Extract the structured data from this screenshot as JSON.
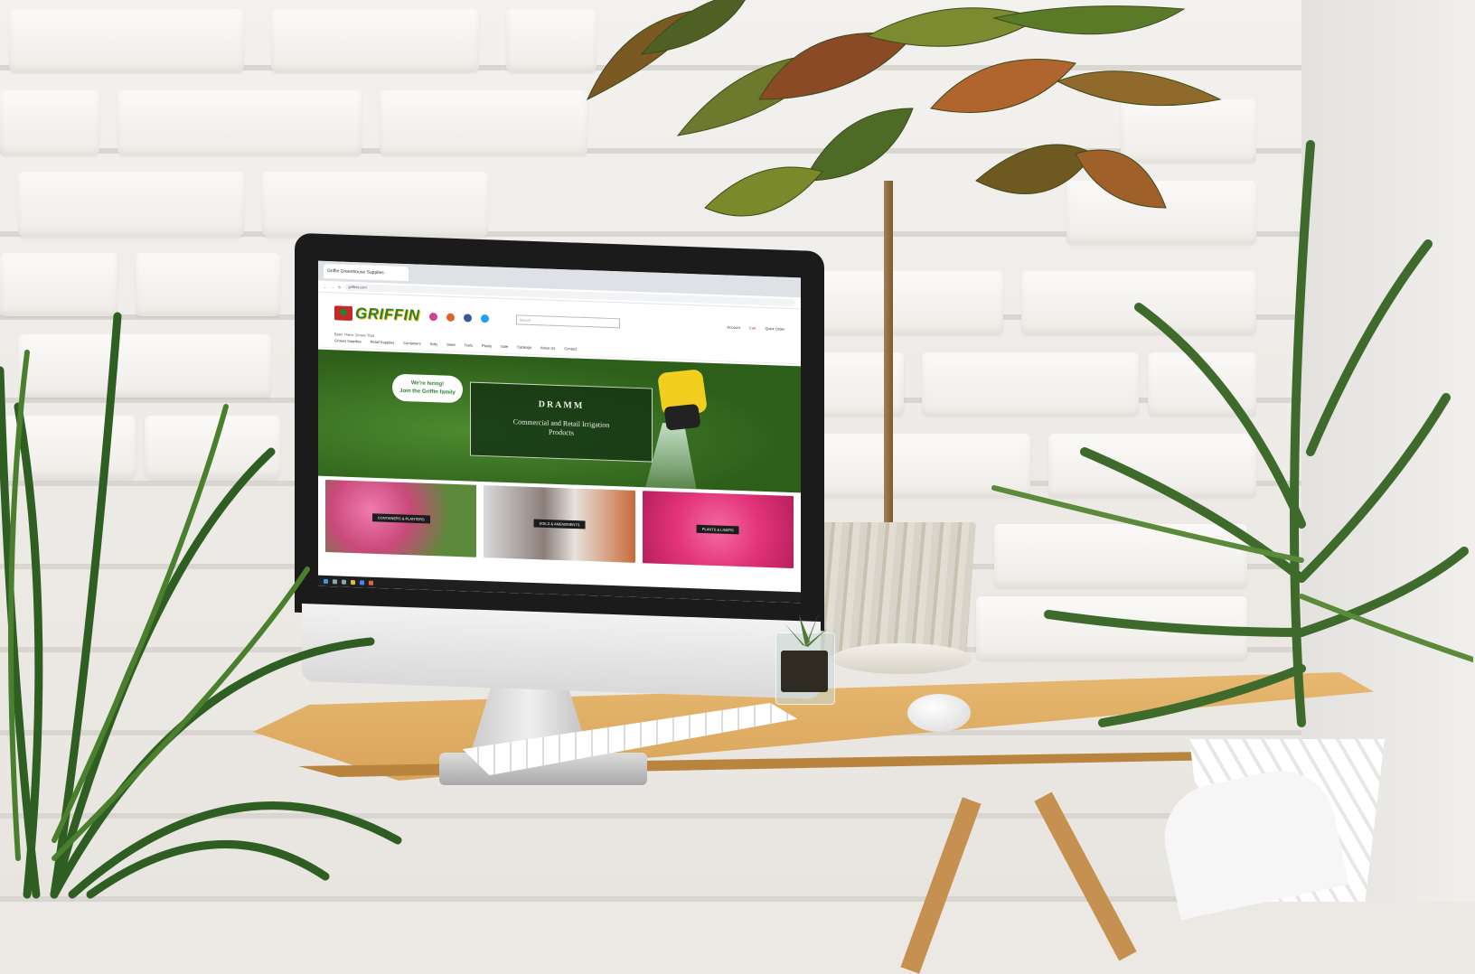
{
  "browser": {
    "tab_title": "Griffin Greenhouse Supplies",
    "url": "griffins.com"
  },
  "site": {
    "logo_text": "GRIFFIN",
    "tagline": "Been There. Grown That.",
    "search_placeholder": "Search",
    "header_links": [
      "Account",
      "Cart",
      "Quick Order"
    ],
    "nav_items": [
      "Grower Supplies",
      "Retail Supplies",
      "Containers",
      "Soils",
      "Seed",
      "Tools",
      "Plants",
      "Sale",
      "Catalogs",
      "About Us",
      "Contact"
    ],
    "hiring_badge": [
      "We're hiring!",
      "Join the Griffin family"
    ],
    "hero_title": "DRAMM",
    "hero_subtitle": "Commercial and Retail Irrigation Products",
    "tiles": [
      {
        "label": "CONTAINERS & PLANTERS",
        "color": "#e85a9a"
      },
      {
        "label": "SOILS & AMENDMENTS",
        "color": "#7f8a8c"
      },
      {
        "label": "PLANTS & LINERS",
        "color": "#e2347a"
      }
    ]
  },
  "colors": {
    "brand_green": "#2e7d32",
    "brand_red": "#c62828",
    "hero_green": "#3e7a24",
    "desk": "#d9a65c"
  }
}
